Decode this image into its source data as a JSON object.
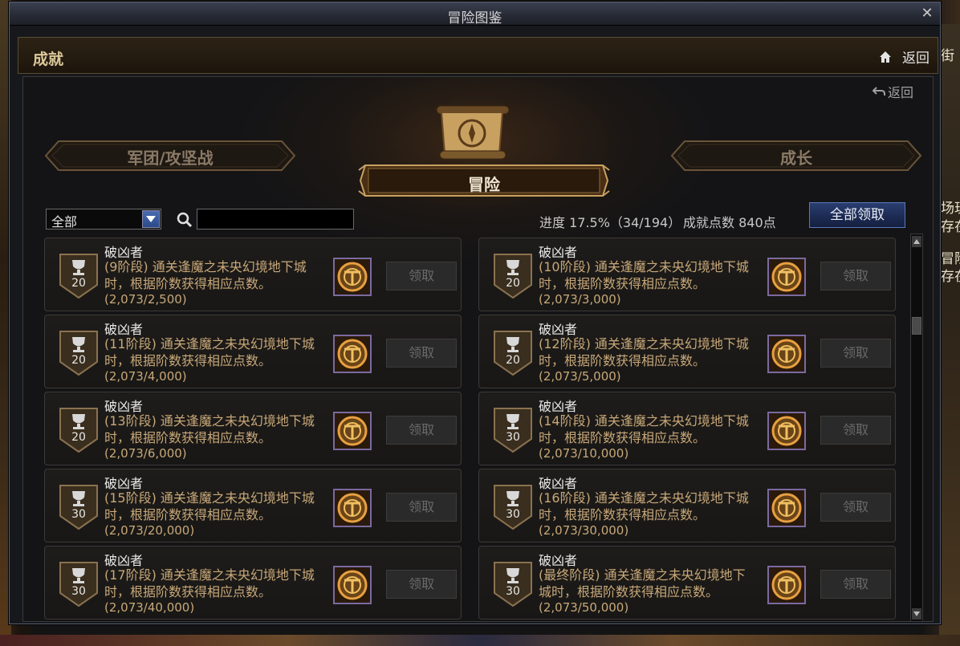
{
  "window": {
    "title": "冒险图鉴",
    "close_glyph": "✕"
  },
  "header": {
    "title": "成就",
    "back_label": "返回"
  },
  "sub_back_label": "返回",
  "categories": {
    "left": "军团/攻坚战",
    "center": "冒险",
    "right": "成长"
  },
  "filter": {
    "selected": "全部",
    "search_value": ""
  },
  "progress": {
    "text": "进度 17.5%（34/194）",
    "points": "成就点数 840点"
  },
  "claim_all_label": "全部领取",
  "achievements": [
    {
      "name": "破凶者",
      "desc": "(9阶段) 通关逢魔之未央幻境地下城时，根据阶数获得相应点数。",
      "progress": "(2,073/2,500)",
      "points": "20",
      "claim": "领取"
    },
    {
      "name": "破凶者",
      "desc": "(10阶段) 通关逢魔之未央幻境地下城时，根据阶数获得相应点数。",
      "progress": "(2,073/3,000)",
      "points": "20",
      "claim": "领取"
    },
    {
      "name": "破凶者",
      "desc": "(11阶段) 通关逢魔之未央幻境地下城时，根据阶数获得相应点数。",
      "progress": "(2,073/4,000)",
      "points": "20",
      "claim": "领取"
    },
    {
      "name": "破凶者",
      "desc": "(12阶段) 通关逢魔之未央幻境地下城时，根据阶数获得相应点数。",
      "progress": "(2,073/5,000)",
      "points": "20",
      "claim": "领取"
    },
    {
      "name": "破凶者",
      "desc": "(13阶段) 通关逢魔之未央幻境地下城时，根据阶数获得相应点数。",
      "progress": "(2,073/6,000)",
      "points": "20",
      "claim": "领取"
    },
    {
      "name": "破凶者",
      "desc": "(14阶段) 通关逢魔之未央幻境地下城时，根据阶数获得相应点数。",
      "progress": "(2,073/10,000)",
      "points": "30",
      "claim": "领取"
    },
    {
      "name": "破凶者",
      "desc": "(15阶段) 通关逢魔之未央幻境地下城时，根据阶数获得相应点数。",
      "progress": "(2,073/20,000)",
      "points": "30",
      "claim": "领取"
    },
    {
      "name": "破凶者",
      "desc": "(16阶段) 通关逢魔之未央幻境地下城时，根据阶数获得相应点数。",
      "progress": "(2,073/30,000)",
      "points": "30",
      "claim": "领取"
    },
    {
      "name": "破凶者",
      "desc": "(17阶段) 通关逢魔之未央幻境地下城时，根据阶数获得相应点数。",
      "progress": "(2,073/40,000)",
      "points": "30",
      "claim": "领取"
    },
    {
      "name": "破凶者",
      "desc": "(最终阶段) 通关逢魔之未央幻境地下城时，根据阶数获得相应点数。",
      "progress": "(2,073/50,000)",
      "points": "30",
      "claim": "领取"
    }
  ],
  "background_fragments": [
    "街",
    "场玩",
    "存在",
    "冒险",
    "存在"
  ],
  "colors": {
    "accent_blue": "#2a3e70",
    "gold_text": "#c8a878",
    "badge_bg": "#3a2e1e"
  }
}
